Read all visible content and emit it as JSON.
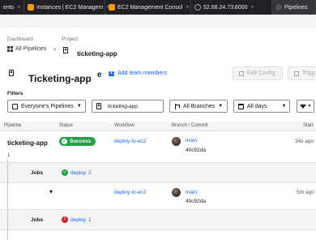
{
  "browser": {
    "tabs": [
      {
        "label": "ents",
        "favicon": "page-icon"
      },
      {
        "label": "Instances | EC2 Managem",
        "favicon": "aws-icon"
      },
      {
        "label": "EC2 Management Consol",
        "favicon": "aws-icon"
      },
      {
        "label": "52.66.24.73:8000",
        "favicon": "globe-icon"
      },
      {
        "label": "Pipelines",
        "favicon": "pipelines-icon"
      }
    ]
  },
  "breadcrumb": {
    "dashboard_label": "Dashboard",
    "all_pipelines": "All Pipelines",
    "project_label": "Project",
    "project_name": "ticketing-app"
  },
  "header": {
    "title": "Ticketing-app",
    "stray_char": "e",
    "add_team_members": "Add team members",
    "edit_config": "Edit Config",
    "trigger": "Trigg"
  },
  "filters": {
    "label": "Filters",
    "pipelines": "Everyone's Pipelines",
    "project": "ticketing-app",
    "branches": "All Branches",
    "days": "All days"
  },
  "table": {
    "columns": [
      "Pipeline",
      "Status",
      "Workflow",
      "Branch / Commit",
      "Start"
    ],
    "rows": [
      {
        "pipeline": "ticketing-app",
        "number": "1",
        "status": "Success",
        "workflow": "deploy-to-ec2",
        "branch": "main",
        "commit": "40c92da",
        "start": "34s ago",
        "jobs_label": "Jobs",
        "job_name": "deploy",
        "job_number": "2"
      },
      {
        "pipeline": "",
        "number": "",
        "status": "",
        "workflow": "deploy-to-ec2",
        "branch": "main",
        "commit": "40c92da",
        "start": "5m ago",
        "jobs_label": "Jobs",
        "job_name": "deploy",
        "job_number": "1"
      }
    ]
  },
  "colors": {
    "success": "#24a148",
    "error": "#da1e28",
    "link": "#0f62fe",
    "tabbar": "#202124"
  }
}
